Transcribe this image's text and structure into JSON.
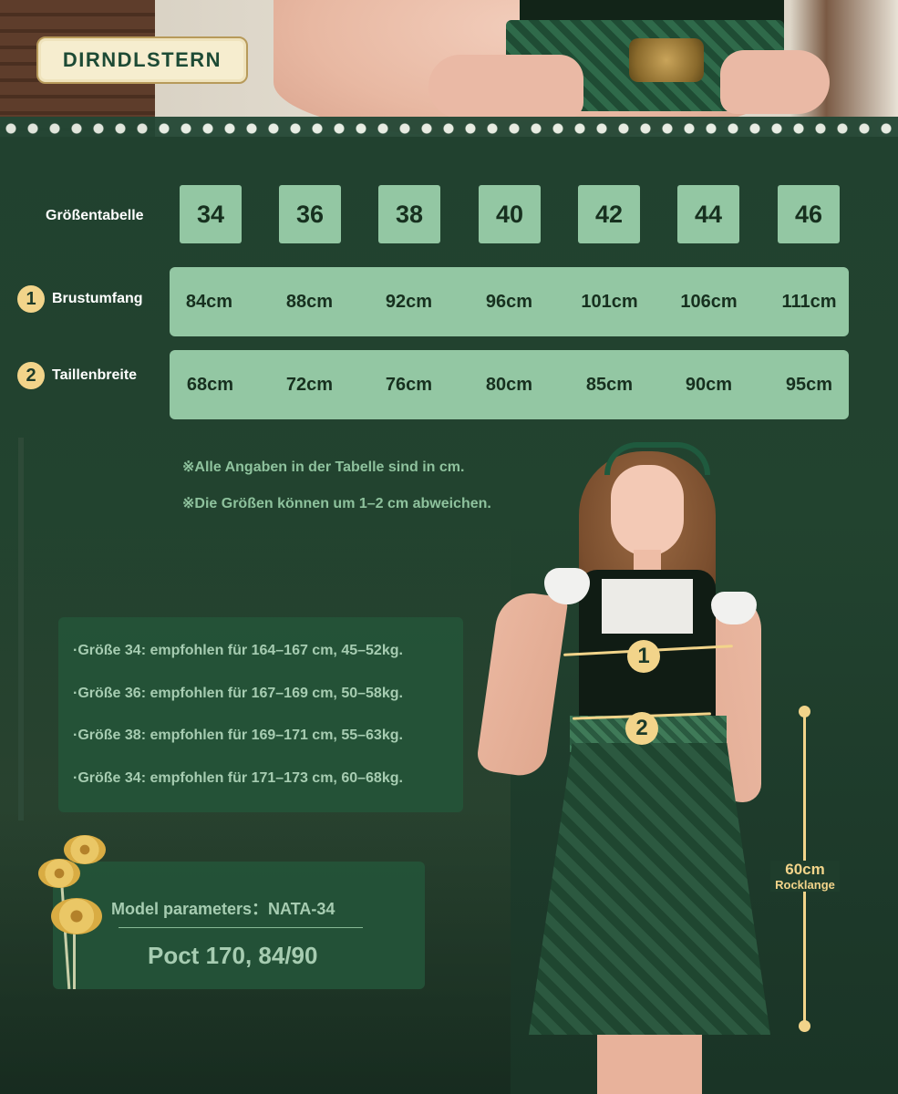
{
  "brand": "DIRNDLSTERN",
  "size_table": {
    "label": "Größentabelle",
    "sizes": [
      "34",
      "36",
      "38",
      "40",
      "42",
      "44",
      "46"
    ]
  },
  "measurements": [
    {
      "number": "1",
      "label": "Brustumfang",
      "values": [
        "84cm",
        "88cm",
        "92cm",
        "96cm",
        "101cm",
        "106cm",
        "111cm"
      ]
    },
    {
      "number": "2",
      "label": "Taillenbreite",
      "values": [
        "68cm",
        "72cm",
        "76cm",
        "80cm",
        "85cm",
        "90cm",
        "95cm"
      ]
    }
  ],
  "notes": [
    "※Alle Angaben in der Tabelle sind in cm.",
    "※Die Größen können um 1–2 cm abweichen."
  ],
  "recommendations": [
    "·Größe 34: empfohlen für 164–167 cm, 45–52kg.",
    "·Größe 36: empfohlen für 167–169 cm, 50–58kg.",
    "·Größe 38: empfohlen für 169–171 cm, 55–63kg.",
    "·Größe 34: empfohlen für 171–173 cm, 60–68kg."
  ],
  "model": {
    "title": "Model parameters：NATA-34",
    "value": "Poct 170, 84/90"
  },
  "figure_markers": [
    "1",
    "2"
  ],
  "skirt_length": {
    "value": "60cm",
    "label": "Rocklange"
  },
  "colors": {
    "background": "#1f3d2c",
    "table_fill": "#93c7a3",
    "accent_gold": "#f2d48a",
    "panel": "#245438"
  }
}
